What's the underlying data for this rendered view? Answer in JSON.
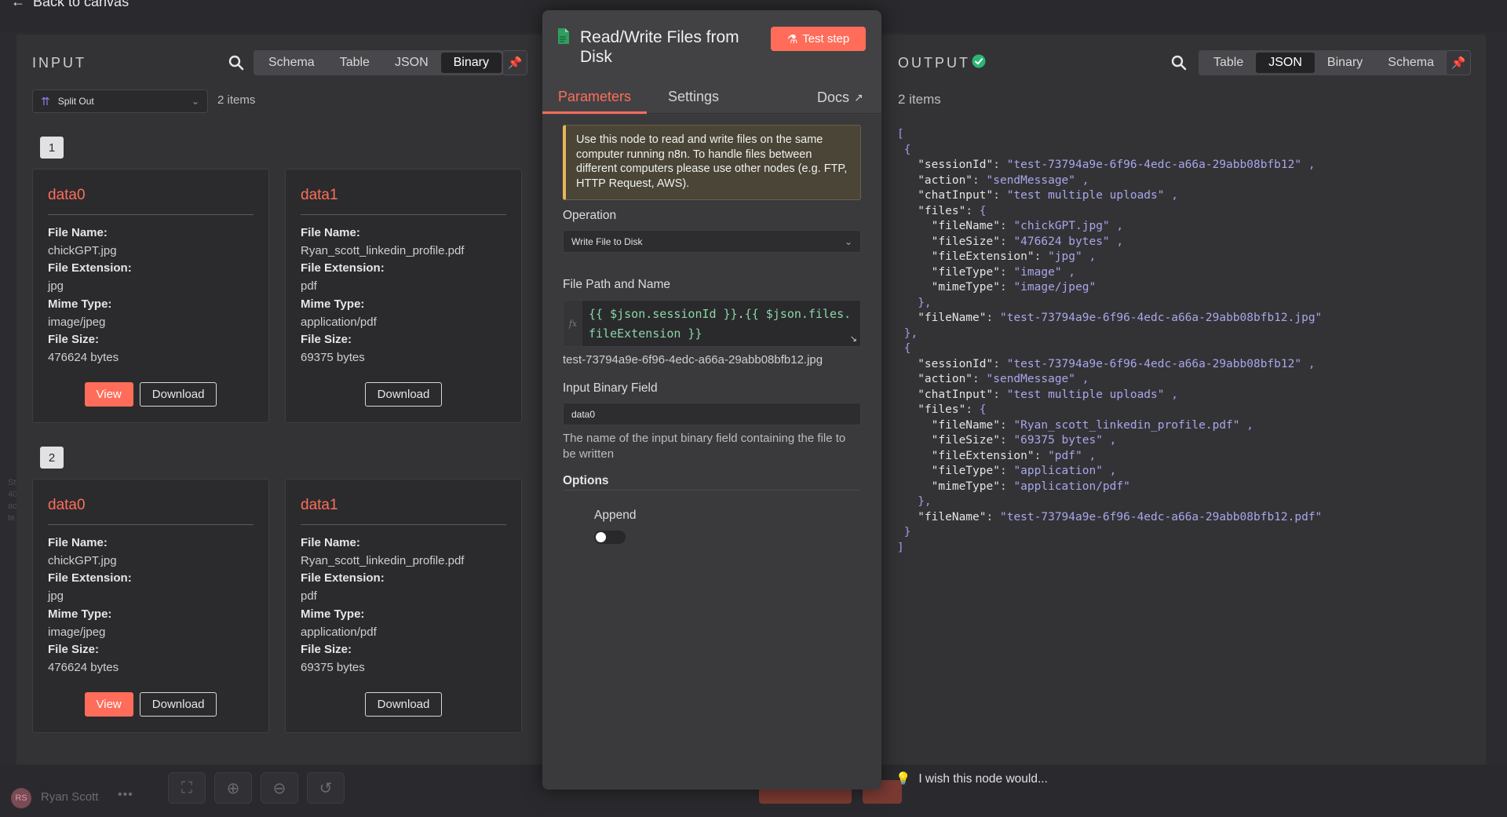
{
  "canvas": {
    "back_label": "Back to canvas",
    "user_initials": "RS",
    "user_name": "Ryan Scott",
    "side_text": [
      "St",
      "40",
      "ac",
      "te"
    ]
  },
  "input": {
    "title": "INPUT",
    "tabs": [
      "Schema",
      "Table",
      "JSON",
      "Binary"
    ],
    "active_tab": "Binary",
    "node_select": "Split Out",
    "items_count": "2 items",
    "items": [
      {
        "index": "1",
        "binaries": [
          {
            "key": "data0",
            "file_name": "chickGPT.jpg",
            "file_extension": "jpg",
            "mime_type": "image/jpeg",
            "file_size": "476624 bytes",
            "view_label": "View",
            "download_label": "Download"
          },
          {
            "key": "data1",
            "file_name": "Ryan_scott_linkedin_profile.pdf",
            "file_extension": "pdf",
            "mime_type": "application/pdf",
            "file_size": "69375 bytes",
            "download_label": "Download"
          }
        ]
      },
      {
        "index": "2",
        "binaries": [
          {
            "key": "data0",
            "file_name": "chickGPT.jpg",
            "file_extension": "jpg",
            "mime_type": "image/jpeg",
            "file_size": "476624 bytes",
            "view_label": "View",
            "download_label": "Download"
          },
          {
            "key": "data1",
            "file_name": "Ryan_scott_linkedin_profile.pdf",
            "file_extension": "pdf",
            "mime_type": "application/pdf",
            "file_size": "69375 bytes",
            "download_label": "Download"
          }
        ]
      }
    ],
    "field_labels": {
      "file_name": "File Name:",
      "file_extension": "File Extension:",
      "mime_type": "Mime Type:",
      "file_size": "File Size:"
    }
  },
  "node": {
    "title": "Read/Write Files from Disk",
    "test_step_label": "Test step",
    "tabs": {
      "parameters": "Parameters",
      "settings": "Settings",
      "docs": "Docs"
    },
    "notice": "Use this node to read and write files on the same computer running n8n. To handle files between different computers please use other nodes (e.g. FTP, HTTP Request, AWS).",
    "operation_label": "Operation",
    "operation_value": "Write File to Disk",
    "file_path_label": "File Path and Name",
    "file_path_expr_part1": "{{ $json.sessionId }}",
    "file_path_expr_dot": ".",
    "file_path_expr_part2": "{{ $json.files.fileExtension }}",
    "fx_label": "fx",
    "file_path_result": "test-73794a9e-6f96-4edc-a66a-29abb08bfb12.jpg",
    "input_binary_label": "Input Binary Field",
    "input_binary_value": "data0",
    "input_binary_help": "The name of the input binary field containing the file to be written",
    "options_label": "Options",
    "append_label": "Append",
    "append_enabled": false
  },
  "output": {
    "title": "OUTPUT",
    "tabs": [
      "Table",
      "JSON",
      "Binary",
      "Schema"
    ],
    "active_tab": "JSON",
    "items_count": "2 items",
    "json": [
      {
        "sessionId": "test-73794a9e-6f96-4edc-a66a-29abb08bfb12",
        "action": "sendMessage",
        "chatInput": "test multiple uploads",
        "files": {
          "fileName": "chickGPT.jpg",
          "fileSize": "476624 bytes",
          "fileExtension": "jpg",
          "fileType": "image",
          "mimeType": "image/jpeg"
        },
        "fileName": "test-73794a9e-6f96-4edc-a66a-29abb08bfb12.jpg"
      },
      {
        "sessionId": "test-73794a9e-6f96-4edc-a66a-29abb08bfb12",
        "action": "sendMessage",
        "chatInput": "test multiple uploads",
        "files": {
          "fileName": "Ryan_scott_linkedin_profile.pdf",
          "fileSize": "69375 bytes",
          "fileExtension": "pdf",
          "fileType": "application",
          "mimeType": "application/pdf"
        },
        "fileName": "test-73794a9e-6f96-4edc-a66a-29abb08bfb12.pdf"
      }
    ]
  },
  "feedback": {
    "text": "I wish this node would..."
  },
  "colors": {
    "accent": "#ff6d5a",
    "success": "#2bb673",
    "panel": "#333336",
    "node_panel": "#424245"
  }
}
